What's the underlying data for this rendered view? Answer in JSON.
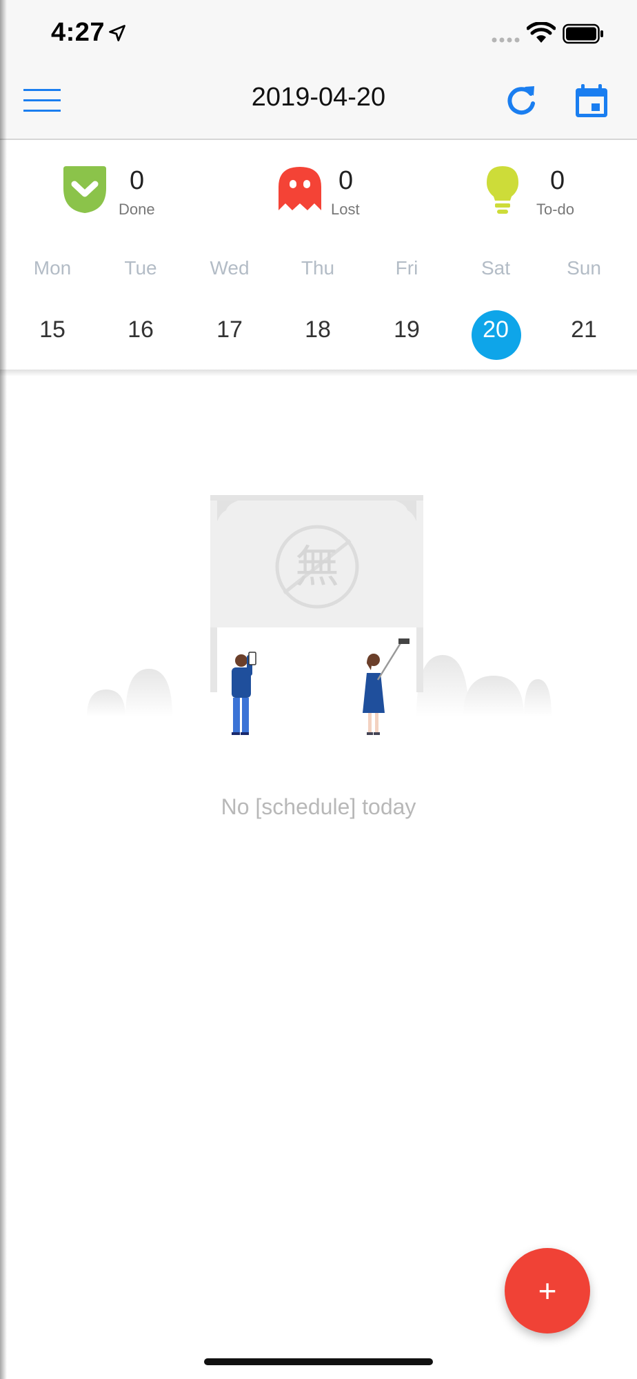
{
  "status_bar": {
    "time": "4:27"
  },
  "nav": {
    "title": "2019-04-20"
  },
  "stats": [
    {
      "count": "0",
      "label": "Done",
      "icon": "shield-check-icon",
      "color": "#8bc34a"
    },
    {
      "count": "0",
      "label": "Lost",
      "icon": "ghost-icon",
      "color": "#f44336"
    },
    {
      "count": "0",
      "label": "To-do",
      "icon": "lightbulb-icon",
      "color": "#cddc39"
    }
  ],
  "week": {
    "days": [
      {
        "name": "Mon",
        "num": "15"
      },
      {
        "name": "Tue",
        "num": "16"
      },
      {
        "name": "Wed",
        "num": "17"
      },
      {
        "name": "Thu",
        "num": "18"
      },
      {
        "name": "Fri",
        "num": "19"
      },
      {
        "name": "Sat",
        "num": "20"
      },
      {
        "name": "Sun",
        "num": "21"
      }
    ],
    "selected_index": 5,
    "selected_color": "#0ea5e9"
  },
  "empty_state": {
    "message": "No [schedule] today",
    "sign_glyph": "無"
  },
  "fab": {
    "label": "+",
    "color": "#f04236"
  },
  "colors": {
    "accent": "#1a7ef0"
  }
}
